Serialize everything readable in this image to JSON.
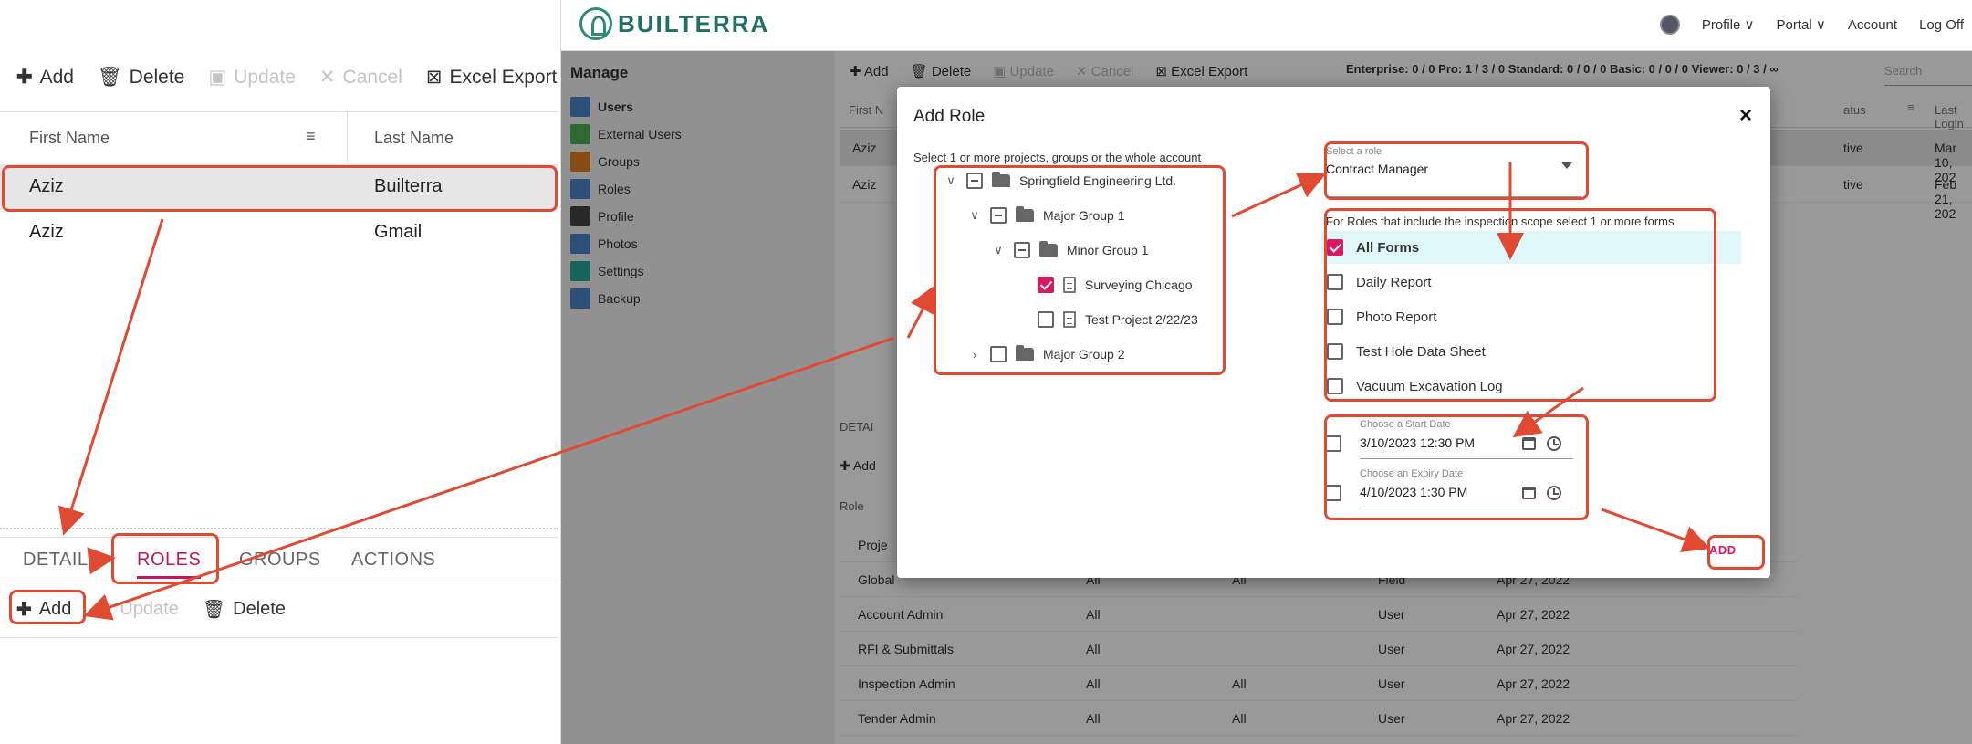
{
  "left_panel": {
    "toolbar": {
      "add": "Add",
      "delete": "Delete",
      "update": "Update",
      "cancel": "Cancel",
      "excel": "Excel Export"
    },
    "columns": {
      "first": "First Name",
      "last": "Last Name"
    },
    "rows": [
      {
        "first": "Aziz",
        "last": "Builterra"
      },
      {
        "first": "Aziz",
        "last": "Gmail"
      }
    ],
    "tabs": [
      "DETAILS",
      "ROLES",
      "GROUPS",
      "ACTIONS"
    ],
    "toolbar2": {
      "add": "Add",
      "update": "Update",
      "delete": "Delete"
    }
  },
  "app": {
    "brand": "BUILTERRA",
    "header_menu": {
      "profile": "Profile ∨",
      "portal": "Portal ∨",
      "account": "Account",
      "logoff": "Log Off"
    },
    "sidebar": {
      "title": "Manage",
      "items": [
        "Users",
        "External Users",
        "Groups",
        "Roles",
        "Profile",
        "Photos",
        "Settings",
        "Backup"
      ]
    },
    "toolbar": {
      "add": "Add",
      "delete": "Delete",
      "update": "Update",
      "cancel": "Cancel",
      "excel": "Excel Export"
    },
    "license": "Enterprise: 0 / 0   Pro: 1 / 3 / 0   Standard: 0 / 0 / 0   Basic: 0 / 0 / 0   Viewer: 0 / 3 / ∞",
    "search_placeholder": "Search",
    "grid_cols": {
      "first": "First N",
      "status": "atus",
      "last_login": "Last Login"
    },
    "grid_rows": [
      {
        "first": "Aziz",
        "status": "tive",
        "last_login": "Mar 10, 202"
      },
      {
        "first": "Aziz",
        "status": "tive",
        "last_login": "Feb 21, 202"
      }
    ],
    "lower": {
      "details": "DETAI",
      "add": "Add",
      "role_col": "Role"
    },
    "role_rows": [
      {
        "role": "Proje",
        "c2": "",
        "c3": "",
        "c4": "",
        "c5": ""
      },
      {
        "role": "Global",
        "c2": "All",
        "c3": "All",
        "c4": "Field",
        "c5": "Apr 27, 2022"
      },
      {
        "role": "Account Admin",
        "c2": "All",
        "c3": "",
        "c4": "User",
        "c5": "Apr 27, 2022"
      },
      {
        "role": "RFI & Submittals",
        "c2": "All",
        "c3": "",
        "c4": "User",
        "c5": "Apr 27, 2022"
      },
      {
        "role": "Inspection Admin",
        "c2": "All",
        "c3": "All",
        "c4": "User",
        "c5": "Apr 27, 2022"
      },
      {
        "role": "Tender Admin",
        "c2": "All",
        "c3": "All",
        "c4": "User",
        "c5": "Apr 27, 2022"
      }
    ]
  },
  "dialog": {
    "title": "Add Role",
    "close": "×",
    "scope_hint": "Select 1 or more projects, groups or the whole account",
    "tree": [
      {
        "label": "Springfield Engineering Ltd.",
        "type": "folder"
      },
      {
        "label": "Major Group 1",
        "type": "folder"
      },
      {
        "label": "Minor Group 1",
        "type": "folder"
      },
      {
        "label": "Surveying Chicago",
        "type": "file"
      },
      {
        "label": "Test Project 2/22/23",
        "type": "file"
      },
      {
        "label": "Major Group 2",
        "type": "folder"
      }
    ],
    "role_select": {
      "label": "Select a role",
      "value": "Contract Manager"
    },
    "forms_hint": "For Roles that include the inspection scope select 1 or more forms",
    "forms": [
      "All Forms",
      "Daily Report",
      "Photo Report",
      "Test Hole Data Sheet",
      "Vacuum Excavation Log"
    ],
    "start_date": {
      "label": "Choose a Start Date",
      "value": "3/10/2023 12:30 PM"
    },
    "expiry_date": {
      "label": "Choose an Expiry Date",
      "value": "4/10/2023 1:30 PM"
    },
    "add_button": "ADD"
  },
  "colors": {
    "accent": "#d81b60",
    "annotation": "#e04a33",
    "brand": "#1f6f63",
    "selected_row": "#e0f7fa"
  }
}
